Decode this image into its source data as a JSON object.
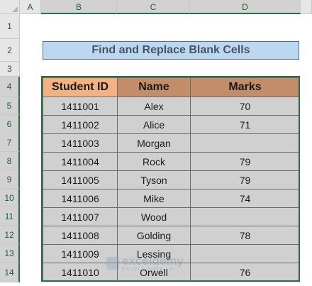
{
  "columns": [
    "A",
    "B",
    "C",
    "D"
  ],
  "rows": [
    "1",
    "2",
    "3",
    "4",
    "5",
    "6",
    "7",
    "8",
    "9",
    "10",
    "11",
    "12",
    "13",
    "14"
  ],
  "title": "Find and Replace Blank Cells",
  "table": {
    "headers": [
      "Student ID",
      "Name",
      "Marks"
    ],
    "rows": [
      {
        "id": "1411001",
        "name": "Alex",
        "marks": "70"
      },
      {
        "id": "1411002",
        "name": "Alice",
        "marks": "71"
      },
      {
        "id": "1411003",
        "name": "Morgan",
        "marks": ""
      },
      {
        "id": "1411004",
        "name": "Rock",
        "marks": "79"
      },
      {
        "id": "1411005",
        "name": "Tyson",
        "marks": "79"
      },
      {
        "id": "1411006",
        "name": "Mike",
        "marks": "74"
      },
      {
        "id": "1411007",
        "name": "Wood",
        "marks": ""
      },
      {
        "id": "1411008",
        "name": "Golding",
        "marks": "78"
      },
      {
        "id": "1411009",
        "name": "Lessing",
        "marks": ""
      },
      {
        "id": "1411010",
        "name": "Orwell",
        "marks": "76"
      }
    ]
  },
  "watermark": {
    "main": "exceldemy",
    "sub": "EXCEL · DATA · BI"
  },
  "colors": {
    "header_id": "#f4b183",
    "header_other": "#c48d6a",
    "data_fill": "#d0d0d0",
    "title_fill": "#bdd7ee",
    "selection": "#217346"
  }
}
